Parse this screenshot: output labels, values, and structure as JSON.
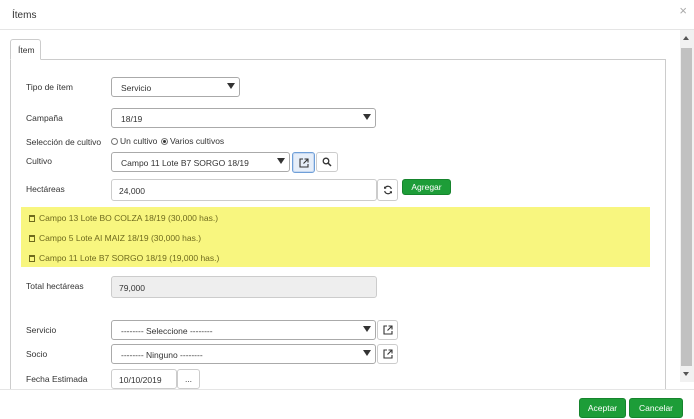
{
  "modal": {
    "title": "Ítems",
    "close_glyph": "×"
  },
  "tab": {
    "label": "Ítem"
  },
  "form": {
    "tipo_item": {
      "label": "Tipo de ítem",
      "value": "Servicio"
    },
    "campana": {
      "label": "Campaña",
      "value": "18/19"
    },
    "seleccion_cultivo": {
      "label": "Selección de cultivo",
      "options": [
        "Un cultivo",
        "Varios cultivos"
      ],
      "selected": "Varios cultivos"
    },
    "cultivo": {
      "label": "Cultivo",
      "value": "Campo 11 Lote B7 SORGO 18/19"
    },
    "hectareas": {
      "label": "Hectáreas",
      "value": "24,000",
      "add_label": "Agregar"
    },
    "crop_list": [
      {
        "text": "Campo 13 Lote BO COLZA 18/19 (30,000 has.)"
      },
      {
        "text": "Campo 5 Lote AI MAIZ 18/19 (30,000 has.)"
      },
      {
        "text": "Campo 11 Lote B7 SORGO 18/19 (19,000 has.)"
      }
    ],
    "total_hectareas": {
      "label": "Total hectáreas",
      "value": "79,000"
    },
    "servicio": {
      "label": "Servicio",
      "value": "-------- Seleccione --------"
    },
    "socio": {
      "label": "Socio",
      "value": "-------- Ninguno --------"
    },
    "fecha_estimada": {
      "label": "Fecha Estimada",
      "value": "10/10/2019",
      "picker_label": "..."
    }
  },
  "footer": {
    "accept_label": "Aceptar",
    "cancel_label": "Cancelar"
  },
  "colors": {
    "accent_green": "#1d9d38",
    "highlight_yellow": "#f8f67f"
  }
}
